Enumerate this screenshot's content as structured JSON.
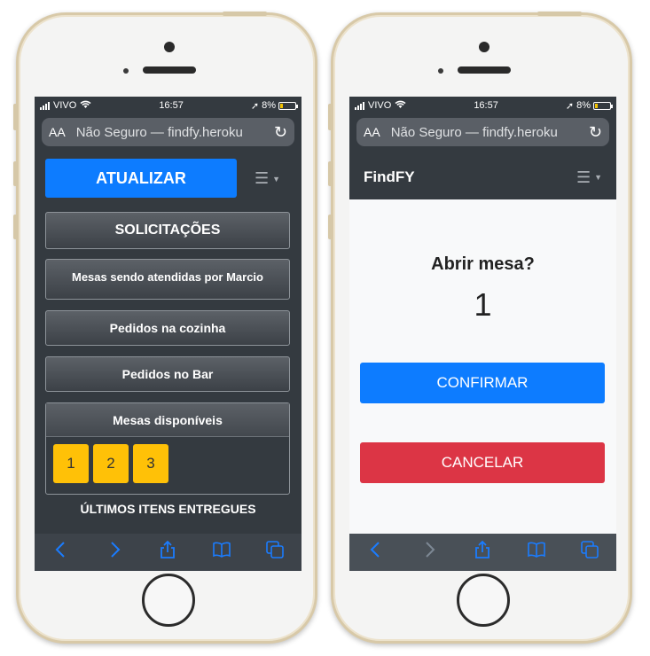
{
  "status_bar": {
    "carrier": "VIVO",
    "time": "16:57",
    "battery": "8%"
  },
  "browser": {
    "aa_label": "AA",
    "url": "Não Seguro — findfy.heroku"
  },
  "left_screen": {
    "refresh_label": "ATUALIZAR",
    "menu_icon": "hamburger-icon",
    "solicitacoes_label": "SOLICITAÇÕES",
    "mesas_atendidas_label": "Mesas sendo atendidas por Marcio",
    "pedidos_cozinha_label": "Pedidos na cozinha",
    "pedidos_bar_label": "Pedidos no Bar",
    "mesas_disponiveis_label": "Mesas disponíveis",
    "mesas": [
      "1",
      "2",
      "3"
    ],
    "ultimos_label": "ÚLTIMOS ITENS ENTREGUES"
  },
  "right_screen": {
    "brand": "FindFY",
    "question": "Abrir mesa?",
    "mesa_number": "1",
    "confirm_label": "CONFIRMAR",
    "cancel_label": "CANCELAR"
  },
  "colors": {
    "primary": "#0d7cff",
    "danger": "#dc3545",
    "warning": "#ffc107",
    "dark": "#343a40"
  },
  "toolbar_icons": [
    "back-icon",
    "forward-icon",
    "share-icon",
    "bookmarks-icon",
    "tabs-icon"
  ]
}
